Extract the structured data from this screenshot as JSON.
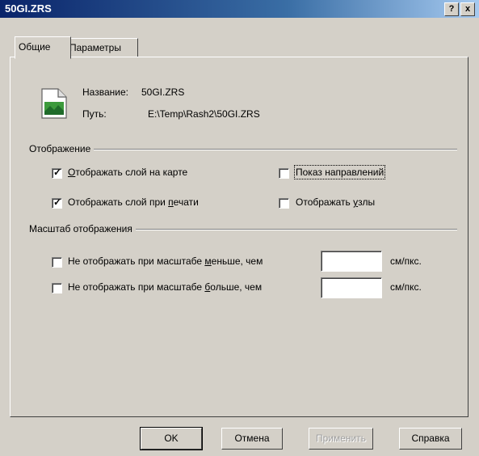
{
  "window": {
    "title": "50GI.ZRS",
    "help_label": "?",
    "close_label": "x"
  },
  "tabs": [
    {
      "label": "Общие"
    },
    {
      "label": "Параметры"
    }
  ],
  "file": {
    "name_label": "Название:",
    "name_value": "50GI.ZRS",
    "path_label": "Путь:",
    "path_value": "E:\\Temp\\Rash2\\50GI.ZRS"
  },
  "display": {
    "title": "Отображение",
    "options": [
      {
        "prefix": "",
        "ul": "О",
        "suffix": "тображать слой на карте",
        "checked": true
      },
      {
        "prefix": "Показ направлений",
        "ul": "",
        "suffix": "",
        "checked": false
      },
      {
        "prefix": "Отображать слой при ",
        "ul": "п",
        "suffix": "ечати",
        "checked": true
      },
      {
        "prefix": "Отображать ",
        "ul": "у",
        "suffix": "злы",
        "checked": false
      }
    ]
  },
  "scale": {
    "title": "Масштаб отображения",
    "rows": [
      {
        "prefix": "Не отображать при масштабе ",
        "ul": "м",
        "suffix": "еньше, чем",
        "checked": false,
        "value": "",
        "unit": "см/пкс."
      },
      {
        "prefix": "Не отображать при масштабе ",
        "ul": "б",
        "suffix": "ольше, чем",
        "checked": false,
        "value": "",
        "unit": "см/пкс."
      }
    ]
  },
  "buttons": {
    "ok": "OK",
    "cancel": "Отмена",
    "apply": "Применить",
    "help": "Справка"
  },
  "check_glyph": "✓",
  "icons": {
    "file": "zrs-file-icon"
  }
}
